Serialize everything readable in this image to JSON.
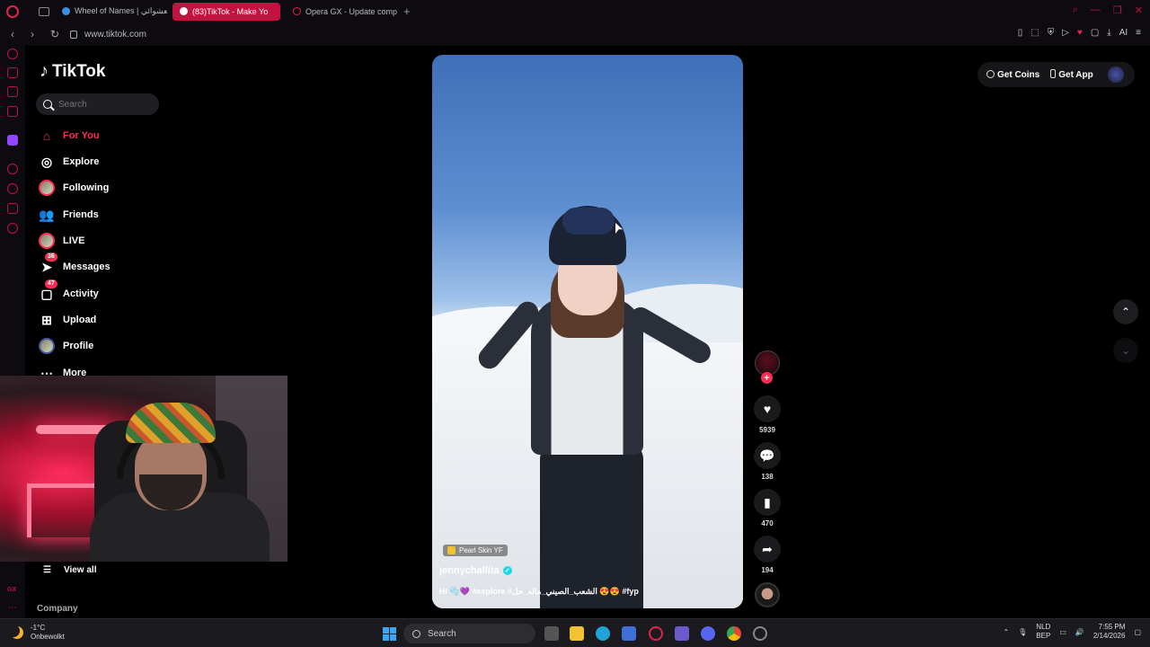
{
  "browser": {
    "tabs": [
      {
        "label": "Wheel of Names | العشوائي",
        "favicon_color": "#3b8ee0"
      },
      {
        "label": "(83)TikTok - Make Yo",
        "favicon_color": "#ffffff"
      },
      {
        "label": "Opera GX - Update comp",
        "favicon_color": "#e0234e"
      }
    ],
    "new_tab": "+",
    "url": "www.tiktok.com",
    "ai_label": "AI"
  },
  "tiktok": {
    "logo": "TikTok",
    "search_placeholder": "Search",
    "nav": [
      {
        "label": "For You",
        "icon": "home-icon",
        "active": true
      },
      {
        "label": "Explore",
        "icon": "compass-icon"
      },
      {
        "label": "Following",
        "icon": "following-avatar-icon"
      },
      {
        "label": "Friends",
        "icon": "friends-icon"
      },
      {
        "label": "LIVE",
        "icon": "live-icon"
      },
      {
        "label": "Messages",
        "icon": "messages-icon",
        "badge": "36"
      },
      {
        "label": "Activity",
        "icon": "activity-icon",
        "badge": "47"
      },
      {
        "label": "Upload",
        "icon": "upload-icon"
      },
      {
        "label": "Profile",
        "icon": "profile-icon"
      },
      {
        "label": "More",
        "icon": "more-icon"
      }
    ],
    "view_all": "View all",
    "company": "Company",
    "header": {
      "get_coins": "Get Coins",
      "get_app": "Get App"
    },
    "video": {
      "sponsor": "Pearl Skin YF",
      "username": "jennychallita",
      "caption": "Hi 🫧💜 #explore #الشعب_الصيني_ماله_حل 😍😍 #fyp"
    },
    "actions": {
      "likes": "5939",
      "comments": "138",
      "saves": "470",
      "shares": "194"
    }
  },
  "taskbar": {
    "temp": "-1°C",
    "weather": "Onbewolkt",
    "search": "Search",
    "lang_top": "NLD",
    "lang_bottom": "BEP",
    "time": "7:55 PM",
    "date": "2/14/2026"
  },
  "colors": {
    "accent": "#fe2c55",
    "opera": "#c2123f"
  }
}
